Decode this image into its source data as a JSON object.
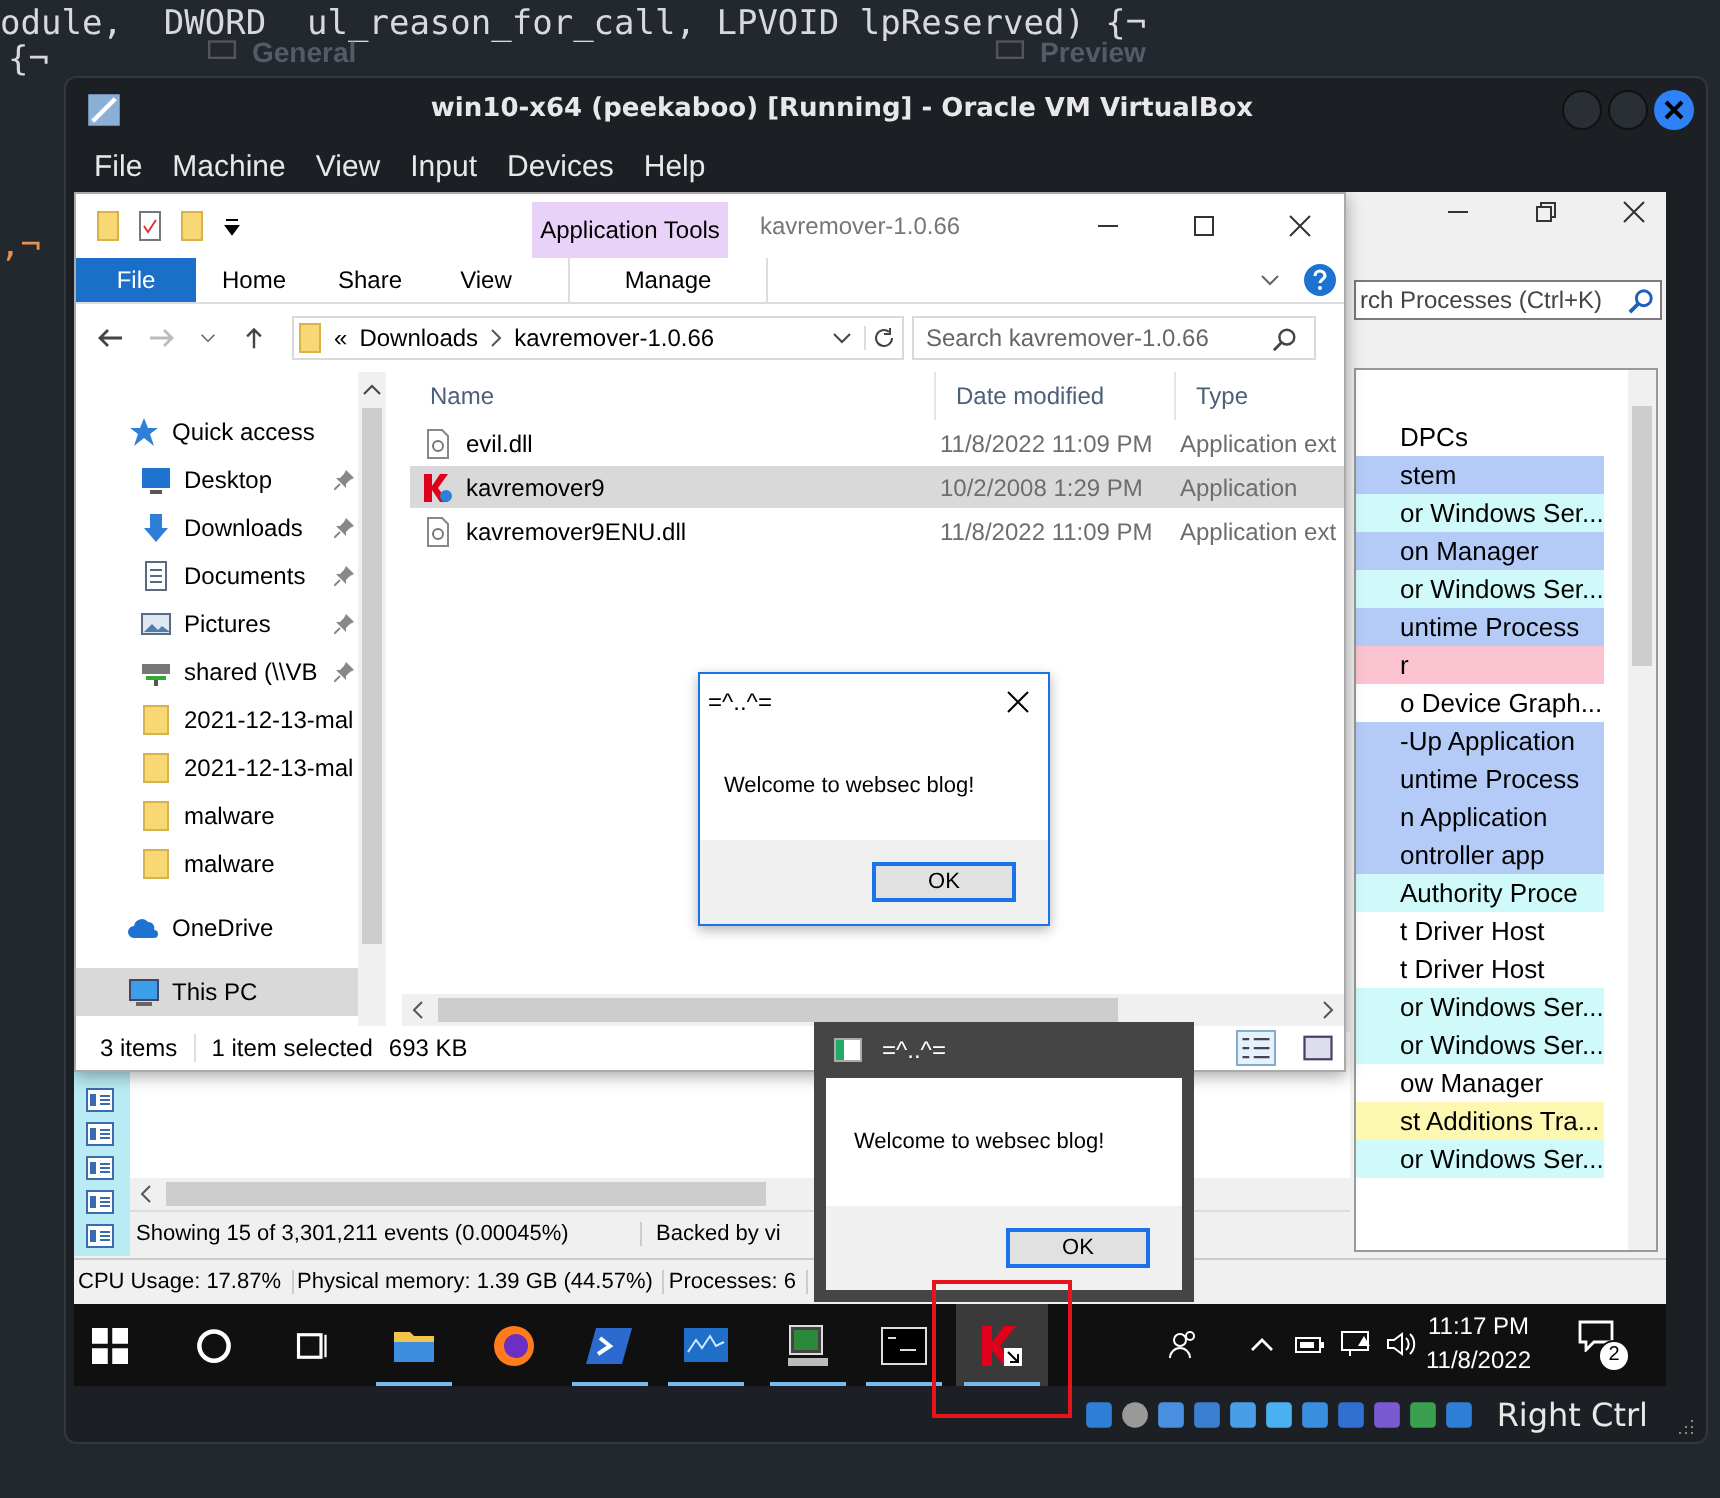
{
  "background_editor": {
    "code_lines": [
      {
        "text": "odule,  DWORD  ul_reason_for_call, LPVOID lpReserved) {¬"
      },
      {
        "text": "{¬"
      },
      {
        "text": ",¬"
      }
    ],
    "panel_tabs": [
      "General",
      "Preview"
    ]
  },
  "vbox": {
    "title": "win10-x64 (peekaboo) [Running] - Oracle VM VirtualBox",
    "menu": [
      "File",
      "Machine",
      "View",
      "Input",
      "Devices",
      "Help"
    ],
    "host_key": "Right Ctrl"
  },
  "process_explorer": {
    "search_placeholder": "rch Processes (Ctrl+K)",
    "rows": [
      {
        "text": "DPCs",
        "color": "#ffffff"
      },
      {
        "text": "stem",
        "color": "#b4cbf8"
      },
      {
        "text": "or Windows Ser...",
        "color": "#d0fafa"
      },
      {
        "text": "on Manager",
        "color": "#b4cbf8"
      },
      {
        "text": "or Windows Ser...",
        "color": "#d0fafa"
      },
      {
        "text": "untime Process",
        "color": "#b4cbf8"
      },
      {
        "text": "r",
        "color": "#fbc3cf"
      },
      {
        "text": "o Device Graph...",
        "color": "#ffffff"
      },
      {
        "text": "-Up Application",
        "color": "#b4cbf8"
      },
      {
        "text": "untime Process",
        "color": "#b4cbf8"
      },
      {
        "text": "n Application",
        "color": "#b4cbf8"
      },
      {
        "text": "ontroller app",
        "color": "#b4cbf8"
      },
      {
        "text": "Authority Proce",
        "color": "#d0fafa"
      },
      {
        "text": "t Driver Host",
        "color": "#ffffff"
      },
      {
        "text": "t Driver Host",
        "color": "#ffffff"
      },
      {
        "text": "or Windows Ser...",
        "color": "#d0fafa"
      },
      {
        "text": "or Windows Ser...",
        "color": "#d0fafa"
      },
      {
        "text": "ow Manager",
        "color": "#ffffff"
      },
      {
        "text": "st Additions Tra...",
        "color": "#fdf8b0"
      },
      {
        "text": "or Windows Ser...",
        "color": "#d0fafa"
      }
    ],
    "status": [
      "CPU Usage: 17.87%",
      "Physical memory: 1.39 GB (44.57%)",
      "Processes: 6"
    ]
  },
  "procmon": {
    "status": [
      "Showing 15 of 3,301,211 events (0.00045%)",
      "Backed by vi"
    ]
  },
  "explorer": {
    "title": "kavremover-1.0.66",
    "context_group": "Application Tools",
    "ribbon_tabs": [
      {
        "label": "File",
        "kind": "file"
      },
      {
        "label": "Home",
        "kind": "tab"
      },
      {
        "label": "Share",
        "kind": "tab"
      },
      {
        "label": "View",
        "kind": "tab"
      },
      {
        "label": "Manage",
        "kind": "context"
      }
    ],
    "address": {
      "prefix": "«",
      "path": [
        "Downloads",
        "kavremover-1.0.66"
      ]
    },
    "search_placeholder": "Search kavremover-1.0.66",
    "nav": [
      {
        "label": "Quick access",
        "kind": "star",
        "selected": false,
        "children": [
          {
            "label": "Desktop",
            "kind": "desktop",
            "pinned": true,
            "selected": false
          },
          {
            "label": "Downloads",
            "kind": "download",
            "pinned": true,
            "selected": false
          },
          {
            "label": "Documents",
            "kind": "document",
            "pinned": true,
            "selected": false
          },
          {
            "label": "Pictures",
            "kind": "picture",
            "pinned": true,
            "selected": false
          },
          {
            "label": "shared (\\\\VB",
            "kind": "drive",
            "pinned": true,
            "selected": false
          },
          {
            "label": "2021-12-13-mal",
            "kind": "folder",
            "pinned": false,
            "selected": false
          },
          {
            "label": "2021-12-13-mal",
            "kind": "folder",
            "pinned": false,
            "selected": false
          },
          {
            "label": "malware",
            "kind": "folder",
            "pinned": false,
            "selected": false
          },
          {
            "label": "malware",
            "kind": "folder",
            "pinned": false,
            "selected": false
          }
        ]
      },
      {
        "label": "OneDrive",
        "kind": "cloud",
        "selected": false
      },
      {
        "label": "This PC",
        "kind": "pc",
        "selected": true
      }
    ],
    "columns": [
      "Name",
      "Date modified",
      "Type"
    ],
    "files": [
      {
        "name": "evil.dll",
        "kind": "dll",
        "date": "11/8/2022 11:09 PM",
        "type": "Application ext",
        "selected": false
      },
      {
        "name": "kavremover9",
        "kind": "app",
        "date": "10/2/2008 1:29 PM",
        "type": "Application",
        "selected": true
      },
      {
        "name": "kavremover9ENU.dll",
        "kind": "dll",
        "date": "11/8/2022 11:09 PM",
        "type": "Application ext",
        "selected": false
      }
    ],
    "status": {
      "count": "3 items",
      "selection": "1 item selected",
      "size": "693 KB"
    }
  },
  "dialogs": [
    {
      "kind": "classic",
      "title": "=^..^=",
      "message": "Welcome to websec blog!",
      "button": "OK"
    },
    {
      "kind": "dark",
      "title": "=^..^=",
      "message": "Welcome to websec blog!",
      "button": "OK"
    }
  ],
  "taskbar": {
    "apps": [
      {
        "running": true,
        "selected": false
      },
      {
        "running": false,
        "selected": false
      },
      {
        "running": true,
        "selected": false
      },
      {
        "running": true,
        "selected": false
      },
      {
        "running": true,
        "selected": false
      },
      {
        "running": true,
        "selected": false
      },
      {
        "running": true,
        "selected": true
      }
    ],
    "time": "11:17 PM",
    "date": "11/8/2022",
    "notifications": "2"
  }
}
